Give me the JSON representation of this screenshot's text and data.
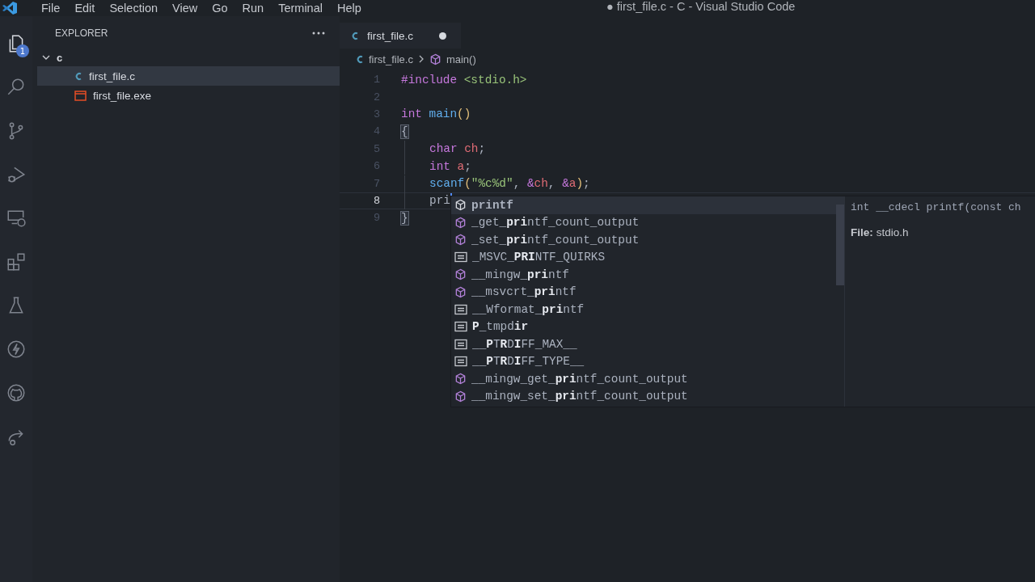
{
  "title_bar": {
    "menu": [
      "File",
      "Edit",
      "Selection",
      "View",
      "Go",
      "Run",
      "Terminal",
      "Help"
    ],
    "title": "● first_file.c - C - Visual Studio Code"
  },
  "activity_bar": {
    "items": [
      {
        "kind": "explorer",
        "selected": true,
        "badge": "1"
      },
      {
        "kind": "search",
        "selected": false
      },
      {
        "kind": "source-control",
        "selected": false
      },
      {
        "kind": "run-debug",
        "selected": false
      },
      {
        "kind": "remote",
        "selected": false
      },
      {
        "kind": "extensions",
        "selected": false
      },
      {
        "kind": "testing",
        "selected": false
      },
      {
        "kind": "lightning",
        "selected": false
      },
      {
        "kind": "github",
        "selected": false
      },
      {
        "kind": "share",
        "selected": false
      }
    ]
  },
  "sidebar": {
    "title": "EXPLORER",
    "folder": {
      "name": "c",
      "expanded": true,
      "files": [
        {
          "name": "first_file.c",
          "kind": "c",
          "selected": true
        },
        {
          "name": "first_file.exe",
          "kind": "exe",
          "selected": false
        }
      ]
    }
  },
  "tabs": [
    {
      "label": "first_file.c",
      "selected": true,
      "modified": true
    }
  ],
  "breadcrumb": {
    "file": "first_file.c",
    "symbol": "main()"
  },
  "editor": {
    "lines": [
      {
        "number": "1",
        "current": false,
        "indented": false,
        "tokens": [
          {
            "kind": "preproc",
            "text": "#include "
          },
          {
            "kind": "header",
            "text": "<stdio.h>"
          }
        ]
      },
      {
        "number": "2",
        "current": false,
        "indented": false
      },
      {
        "number": "3",
        "current": false,
        "indented": false,
        "tokens": [
          {
            "kind": "keyword",
            "text": "int "
          },
          {
            "kind": "function",
            "text": "main"
          },
          {
            "kind": "paren",
            "text": "()"
          }
        ]
      },
      {
        "number": "4",
        "current": false,
        "indented": false,
        "tokens": [
          {
            "kind": "bracket",
            "text": "{"
          }
        ]
      },
      {
        "number": "5",
        "current": false,
        "indented": true,
        "tokens": [
          {
            "kind": "keyword",
            "text": "char "
          },
          {
            "kind": "variable",
            "text": "ch"
          },
          {
            "kind": "plain",
            "text": ";"
          }
        ]
      },
      {
        "number": "6",
        "current": false,
        "indented": true,
        "tokens": [
          {
            "kind": "keyword",
            "text": "int "
          },
          {
            "kind": "variable",
            "text": "a"
          },
          {
            "kind": "plain",
            "text": ";"
          }
        ]
      },
      {
        "number": "7",
        "current": false,
        "indented": true,
        "tokens": [
          {
            "kind": "function",
            "text": "scanf"
          },
          {
            "kind": "paren",
            "text": "("
          },
          {
            "kind": "string",
            "text": "\"%c%d\""
          },
          {
            "kind": "plain",
            "text": ", "
          },
          {
            "kind": "operator",
            "text": "&"
          },
          {
            "kind": "variable",
            "text": "ch"
          },
          {
            "kind": "plain",
            "text": ", "
          },
          {
            "kind": "operator",
            "text": "&"
          },
          {
            "kind": "variable",
            "text": "a"
          },
          {
            "kind": "paren",
            "text": ")"
          },
          {
            "kind": "plain",
            "text": ";"
          }
        ]
      },
      {
        "number": "8",
        "current": true,
        "indented": true,
        "tokens": [
          {
            "kind": "plain",
            "text": "pri"
          }
        ]
      },
      {
        "number": "9",
        "current": false,
        "indented": false,
        "tokens": [
          {
            "kind": "bracket",
            "text": "}"
          }
        ]
      }
    ]
  },
  "suggest": {
    "items": [
      {
        "label": "printf",
        "kind": "function",
        "selected": true
      },
      {
        "label": "_get_**pri**ntf_count_output",
        "kind": "function",
        "selected": false
      },
      {
        "label": "_set_**pri**ntf_count_output",
        "kind": "function",
        "selected": false
      },
      {
        "label": "_MSVC_**PRI**NTF_QUIRKS",
        "kind": "constant",
        "selected": false
      },
      {
        "label": "__mingw_**pri**ntf",
        "kind": "function",
        "selected": false
      },
      {
        "label": "__msvcrt_**pri**ntf",
        "kind": "function",
        "selected": false
      },
      {
        "label": "__Wformat_**pri**ntf",
        "kind": "constant",
        "selected": false
      },
      {
        "label": "**P**_tmpd**ir**",
        "kind": "constant",
        "selected": false
      },
      {
        "label": "__**P**T**R**D**I**FF_MAX__",
        "kind": "constant",
        "selected": false
      },
      {
        "label": "__**P**T**R**D**I**FF_TYPE__",
        "kind": "constant",
        "selected": false
      },
      {
        "label": "__mingw_get_**pri**ntf_count_output",
        "kind": "function",
        "selected": false
      },
      {
        "label": "__mingw_set_**pri**ntf_count_output",
        "kind": "function",
        "selected": false
      }
    ],
    "detail": {
      "signature": "int __cdecl printf(const ch",
      "file_label": "File:",
      "file": "stdio.h"
    }
  }
}
